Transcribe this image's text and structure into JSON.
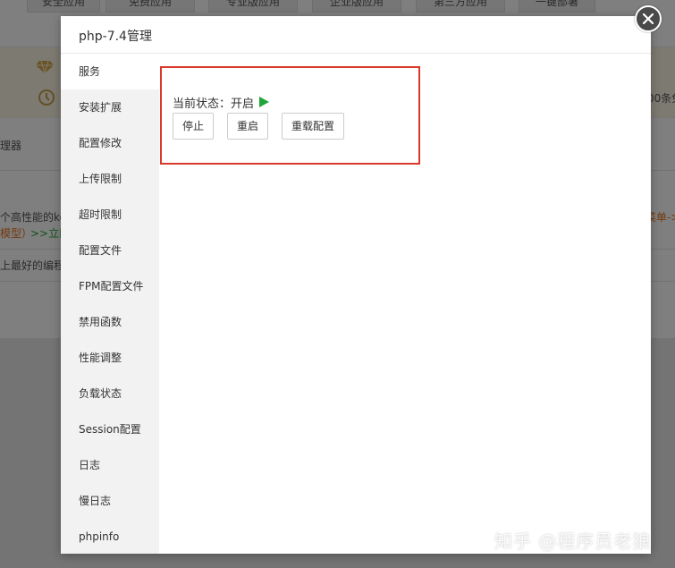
{
  "background": {
    "tabs": [
      "安全应用",
      "免费应用",
      "专业版应用",
      "企业版应用",
      "第三方应用",
      "一键部署"
    ],
    "fragments": {
      "right_banner": "00条免",
      "manager": "理器",
      "desc1": "个高性能的ke",
      "desc1_right": "菜单->",
      "desc2_orange": "模型）",
      "desc2_green": ">>立即",
      "desc3": "上最好的编程"
    }
  },
  "dialog": {
    "title": "php-7.4管理",
    "sidebar": [
      {
        "label": "服务",
        "active": true
      },
      {
        "label": "安装扩展",
        "active": false
      },
      {
        "label": "配置修改",
        "active": false
      },
      {
        "label": "上传限制",
        "active": false
      },
      {
        "label": "超时限制",
        "active": false
      },
      {
        "label": "配置文件",
        "active": false
      },
      {
        "label": "FPM配置文件",
        "active": false
      },
      {
        "label": "禁用函数",
        "active": false
      },
      {
        "label": "性能调整",
        "active": false
      },
      {
        "label": "负载状态",
        "active": false
      },
      {
        "label": "Session配置",
        "active": false
      },
      {
        "label": "日志",
        "active": false
      },
      {
        "label": "慢日志",
        "active": false
      },
      {
        "label": "phpinfo",
        "active": false
      }
    ],
    "service": {
      "status_label": "当前状态：",
      "status_value": "开启",
      "buttons": {
        "stop": "停止",
        "restart": "重启",
        "reload": "重载配置"
      }
    }
  },
  "watermark": "知乎 @程序员老狼",
  "colors": {
    "highlight_border": "#d8392b",
    "status_play": "#20a53a",
    "link_orange": "#e8731c",
    "link_green": "#20a53a"
  }
}
